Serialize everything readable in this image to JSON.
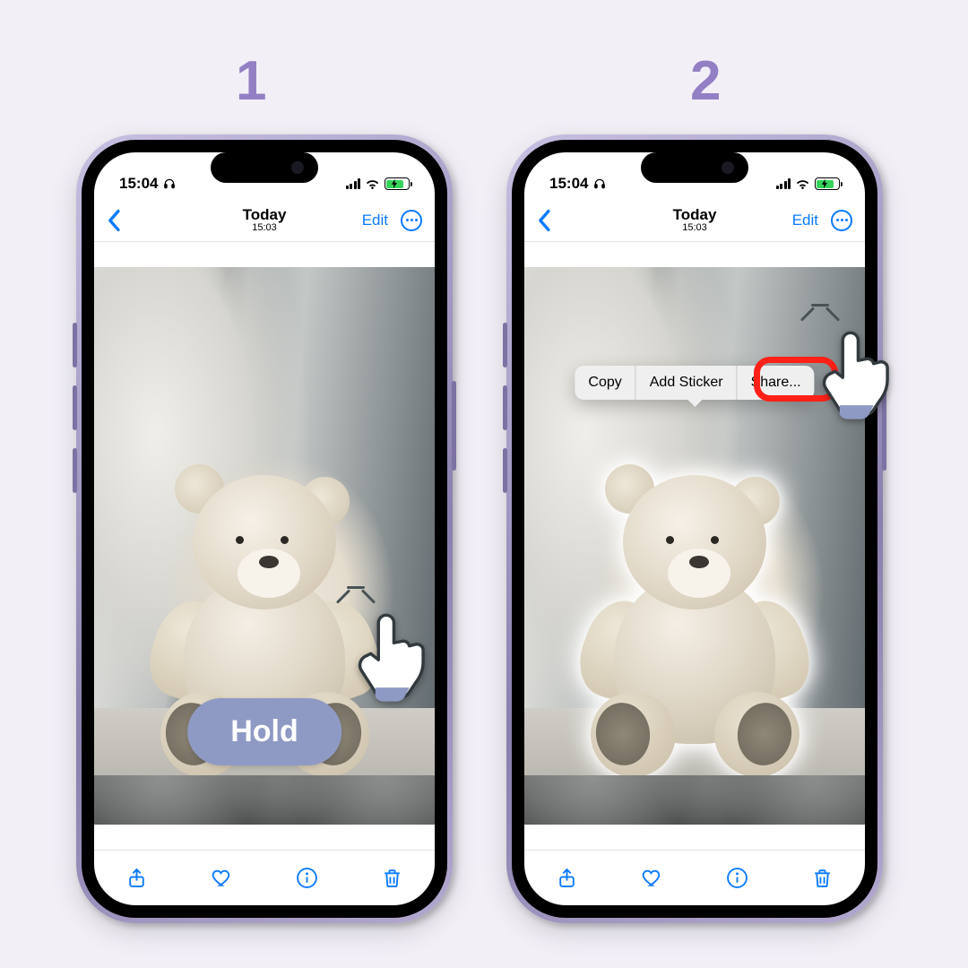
{
  "labels": {
    "step1": "1",
    "step2": "2"
  },
  "status": {
    "time": "15:04"
  },
  "nav": {
    "title": "Today",
    "subtitle": "15:03",
    "edit": "Edit"
  },
  "annot": {
    "hold": "Hold"
  },
  "menu": {
    "copy": "Copy",
    "sticker": "Add Sticker",
    "share": "Share..."
  }
}
